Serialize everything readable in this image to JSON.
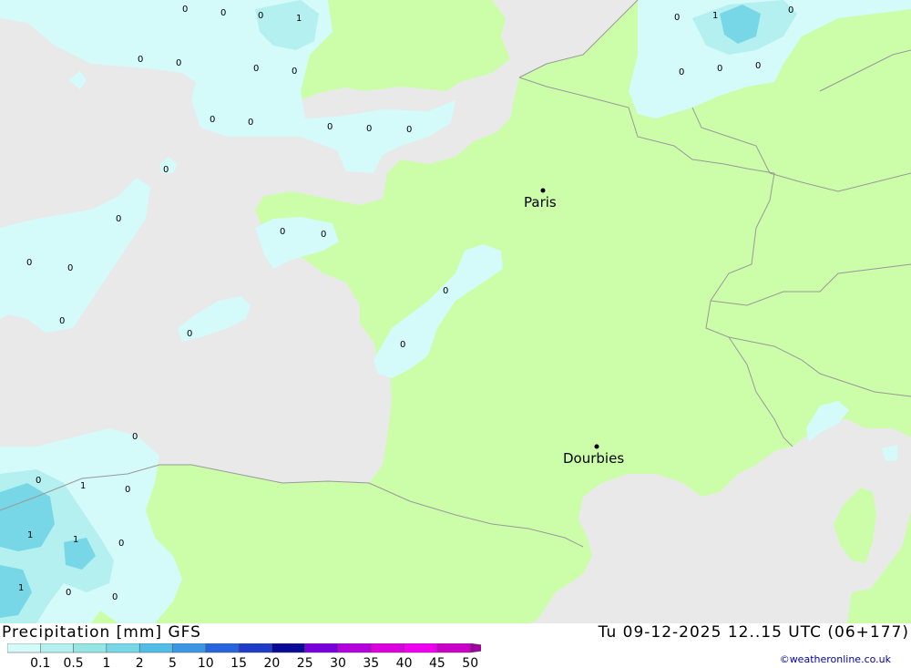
{
  "title": {
    "label": "Precipitation [mm] GFS",
    "datetime": "Tu 09-12-2025 12..15 UTC (06+177)"
  },
  "credit": "©weatheronline.co.uk",
  "legend": {
    "ticks": [
      "0.1",
      "0.5",
      "1",
      "2",
      "5",
      "10",
      "15",
      "20",
      "25",
      "30",
      "35",
      "40",
      "45",
      "50"
    ],
    "colors": [
      "#d4fafa",
      "#b4f0f0",
      "#96e6e6",
      "#78d7e6",
      "#50bee6",
      "#3c96e6",
      "#2864dc",
      "#1e3cc8",
      "#0a0a96",
      "#7800dc",
      "#b400dc",
      "#dc00dc",
      "#f000f0",
      "#c800c8",
      "#a000a0"
    ]
  },
  "colors": {
    "sea": "#e9e9e9",
    "land": "#ccfeaa",
    "precip_light": "#d4fafa",
    "precip_mid": "#b4f0f0",
    "precip_heavy": "#78d7e6",
    "border": "#999999"
  },
  "cities": [
    {
      "name": "Paris"
    },
    {
      "name": "Dourbies"
    }
  ],
  "values": [
    "0",
    "0",
    "0",
    "1",
    "0",
    "1",
    "0",
    "0",
    "0",
    "0",
    "0",
    "0",
    "0",
    "0",
    "0",
    "0",
    "0",
    "0",
    "0",
    "0",
    "0",
    "0",
    "0",
    "0",
    "0",
    "0",
    "0",
    "0",
    "0",
    "0",
    "0",
    "1",
    "0",
    "1",
    "1",
    "0",
    "1",
    "0",
    "0"
  ]
}
